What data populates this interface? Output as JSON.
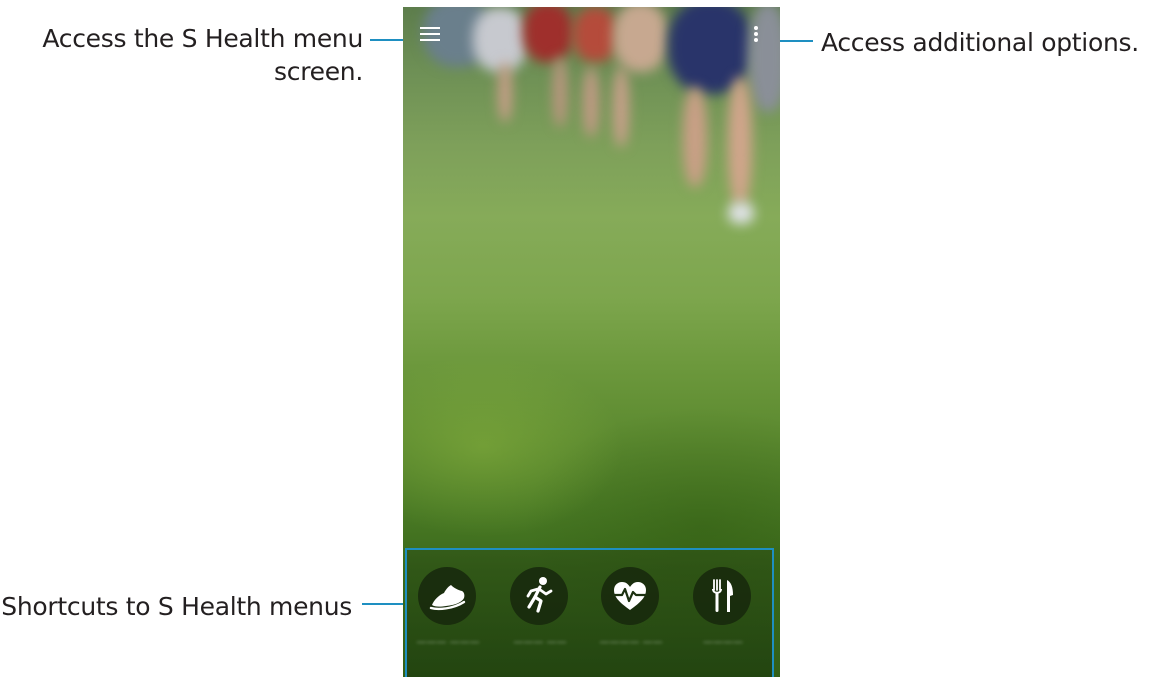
{
  "callouts": {
    "menu_line1": "Access the S Health menu",
    "menu_line2": "screen.",
    "options": "Access additional options.",
    "shortcuts": "Shortcuts to S Health menus"
  },
  "colors": {
    "accent": "#1e8fc1",
    "callout_text": "#231f20",
    "shortcut_circle": "#16260c"
  },
  "phone": {
    "background": "runners-on-grass-photo",
    "top_left_icon": "hamburger-menu-icon",
    "top_right_icon": "more-options-icon",
    "shortcuts": [
      {
        "icon": "shoe-icon"
      },
      {
        "icon": "runner-icon"
      },
      {
        "icon": "heart-rate-icon"
      },
      {
        "icon": "fork-knife-icon"
      }
    ]
  }
}
